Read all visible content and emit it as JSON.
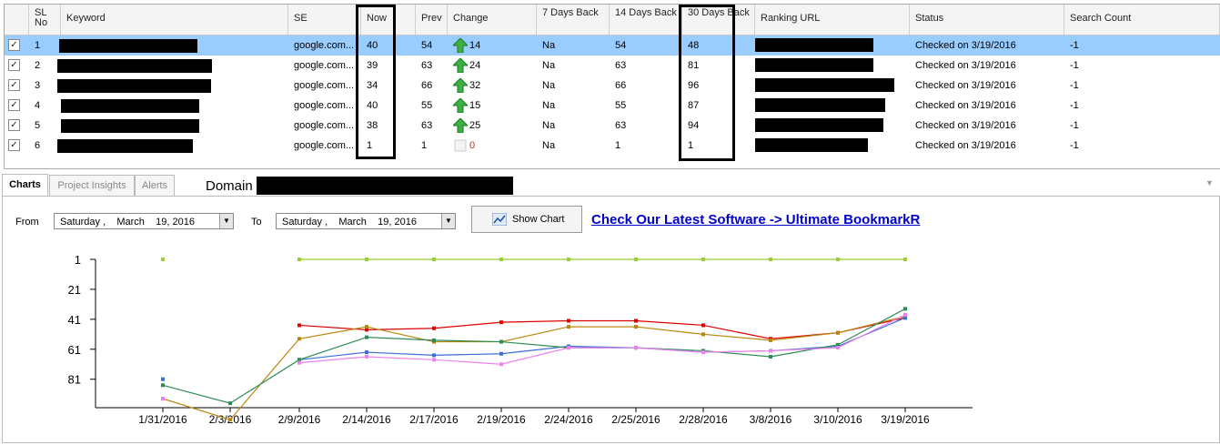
{
  "grid": {
    "headers": {
      "sl_no": "SL No",
      "keyword": "Keyword",
      "se": "SE",
      "now": "Now",
      "prev": "Prev",
      "change": "Change",
      "days7": "7 Days Back",
      "days14": "14 Days Back",
      "days30": "30 Days Back",
      "ranking_url": "Ranking URL",
      "status": "Status",
      "search_count": "Search Count"
    },
    "rows": [
      {
        "sl": "1",
        "se": "google.com...",
        "now": "40",
        "prev": "54",
        "change": "14",
        "d7": "Na",
        "d14": "54",
        "d30": "48",
        "status": "Checked on 3/19/2016",
        "count": "-1",
        "checked": "✓",
        "trend": "up"
      },
      {
        "sl": "2",
        "se": "google.com...",
        "now": "39",
        "prev": "63",
        "change": "24",
        "d7": "Na",
        "d14": "63",
        "d30": "81",
        "status": "Checked on 3/19/2016",
        "count": "-1",
        "checked": "✓",
        "trend": "up"
      },
      {
        "sl": "3",
        "se": "google.com...",
        "now": "34",
        "prev": "66",
        "change": "32",
        "d7": "Na",
        "d14": "66",
        "d30": "96",
        "status": "Checked on 3/19/2016",
        "count": "-1",
        "checked": "✓",
        "trend": "up"
      },
      {
        "sl": "4",
        "se": "google.com...",
        "now": "40",
        "prev": "55",
        "change": "15",
        "d7": "Na",
        "d14": "55",
        "d30": "87",
        "status": "Checked on 3/19/2016",
        "count": "-1",
        "checked": "✓",
        "trend": "up"
      },
      {
        "sl": "5",
        "se": "google.com...",
        "now": "38",
        "prev": "63",
        "change": "25",
        "d7": "Na",
        "d14": "63",
        "d30": "94",
        "status": "Checked on 3/19/2016",
        "count": "-1",
        "checked": "✓",
        "trend": "up"
      },
      {
        "sl": "6",
        "se": "google.com...",
        "now": "1",
        "prev": "1",
        "change": "0",
        "d7": "Na",
        "d14": "1",
        "d30": "1",
        "status": "Checked on 3/19/2016",
        "count": "-1",
        "checked": "✓",
        "trend": "none"
      }
    ]
  },
  "tabs": {
    "charts": "Charts",
    "insights": "Project Insights",
    "alerts": "Alerts"
  },
  "domain_label": "Domain",
  "filters": {
    "from_label": "From",
    "to_label": "To",
    "from_value": "Saturday ,    March    19, 2016",
    "to_value": "Saturday ,    March    19, 2016",
    "show_chart": "Show Chart",
    "promo_link": "Check Our Latest Software -> Ultimate BookmarkR"
  },
  "icons": {
    "change_up": "green-up-arrow-icon",
    "dropdown": "chevron-down-icon",
    "chart": "chart-icon"
  },
  "colors": {
    "selection": "#99ccff",
    "arrow_green": "#2e9b2e",
    "link": "#0000cc"
  },
  "chart_data": {
    "type": "line",
    "categories": [
      "1/31/2016",
      "2/3/2016",
      "2/9/2016",
      "2/14/2016",
      "2/17/2016",
      "2/19/2016",
      "2/24/2016",
      "2/25/2016",
      "2/28/2016",
      "3/8/2016",
      "3/10/2016",
      "3/19/2016"
    ],
    "yticks": [
      "1",
      "21",
      "41",
      "61",
      "81"
    ],
    "ylim": [
      1,
      100
    ],
    "y_inverted": true,
    "series": [
      {
        "color": "#9acd32",
        "values": [
          1,
          null,
          1,
          1,
          1,
          1,
          1,
          1,
          1,
          1,
          1,
          1
        ]
      },
      {
        "color": "#e00000",
        "values": [
          null,
          null,
          45,
          48,
          47,
          43,
          42,
          42,
          45,
          54,
          50,
          40
        ]
      },
      {
        "color": "#b8860b",
        "values": [
          94,
          108,
          54,
          46,
          56,
          56,
          46,
          46,
          51,
          55,
          50,
          39
        ]
      },
      {
        "color": "#3b6fd6",
        "values": [
          81,
          null,
          68,
          63,
          65,
          64,
          59,
          60,
          63,
          62,
          59,
          40
        ]
      },
      {
        "color": "#2e8b57",
        "values": [
          85,
          97,
          68,
          53,
          55,
          56,
          60,
          60,
          62,
          66,
          58,
          34
        ]
      },
      {
        "color": "#ee82ee",
        "values": [
          94,
          null,
          70,
          66,
          68,
          71,
          60,
          60,
          63,
          62,
          60,
          38
        ]
      }
    ]
  }
}
